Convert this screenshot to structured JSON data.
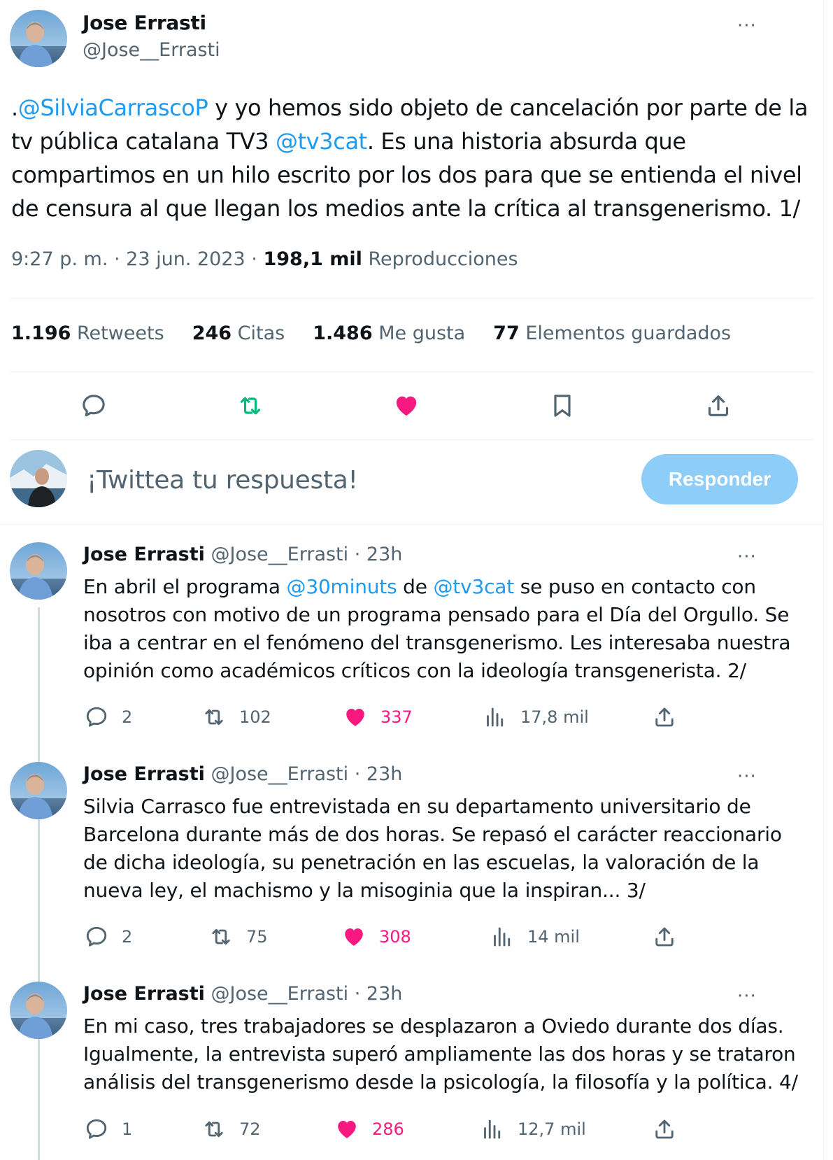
{
  "main": {
    "name": "Jose Errasti",
    "handle": "@Jose__Errasti",
    "more": "···",
    "text_prefix": ".",
    "mention1": "@SilviaCarrascoP",
    "text_mid1": " y yo hemos sido objeto de cancelación por parte de la tv pública catalana TV3 ",
    "mention2": "@tv3cat",
    "text_rest": ". Es una historia absurda que compartimos en un hilo escrito por los dos para que se entienda el nivel de censura al que llegan los medios ante la crítica al transgenerismo. 1/",
    "time": "9:27 p. m. · 23 jun. 2023 · ",
    "views_count": "198,1 mil",
    "views_label": " Reproducciones",
    "stats": {
      "retweets_count": "1.196",
      "retweets_label": " Retweets",
      "quotes_count": "246",
      "quotes_label": " Citas",
      "likes_count": "1.486",
      "likes_label": " Me gusta",
      "bookmarks_count": "77",
      "bookmarks_label": " Elementos guardados"
    }
  },
  "icons": {
    "reply": "reply-icon",
    "retweet": "retweet-icon",
    "like": "heart-icon",
    "bookmark": "bookmark-icon",
    "share": "share-icon",
    "views": "views-icon"
  },
  "colors": {
    "link": "#1d9bf0",
    "retweet_active": "#00ba7c",
    "like_active": "#f91880",
    "muted": "#536471",
    "reply_button": "#8ecdf7"
  },
  "composer": {
    "placeholder": "¡Twittea tu respuesta!",
    "button": "Responder"
  },
  "thread": [
    {
      "name": "Jose Errasti",
      "handle": "@Jose__Errasti",
      "sep": " · ",
      "time": "23h",
      "t1": "En abril el programa ",
      "m1": "@30minuts",
      "t2": " de ",
      "m2": "@tv3cat",
      "t3": " se puso en contacto con nosotros con motivo de un programa pensado para el Día del Orgullo. Se iba a centrar en el fenómeno del transgenerismo. Les interesaba nuestra opinión como académicos críticos con la ideología transgenerista. 2/",
      "replies": "2",
      "retweets": "102",
      "likes": "337",
      "views": "17,8 mil"
    },
    {
      "name": "Jose Errasti",
      "handle": "@Jose__Errasti",
      "sep": " · ",
      "time": "23h",
      "t1": "Silvia Carrasco fue entrevistada en su departamento universitario de Barcelona durante más de dos horas. Se repasó el carácter reaccionario de dicha ideología, su penetración en las escuelas, la valoración de la nueva ley, el machismo y la misoginia que la inspiran... 3/",
      "replies": "2",
      "retweets": "75",
      "likes": "308",
      "views": "14 mil"
    },
    {
      "name": "Jose Errasti",
      "handle": "@Jose__Errasti",
      "sep": " · ",
      "time": "23h",
      "t1": "En mi caso, tres trabajadores se desplazaron a Oviedo durante dos días. Igualmente, la entrevista superó ampliamente las dos horas y se trataron análisis del transgenerismo desde la psicología, la filosofía y la política. 4/",
      "replies": "1",
      "retweets": "72",
      "likes": "286",
      "views": "12,7 mil"
    }
  ]
}
